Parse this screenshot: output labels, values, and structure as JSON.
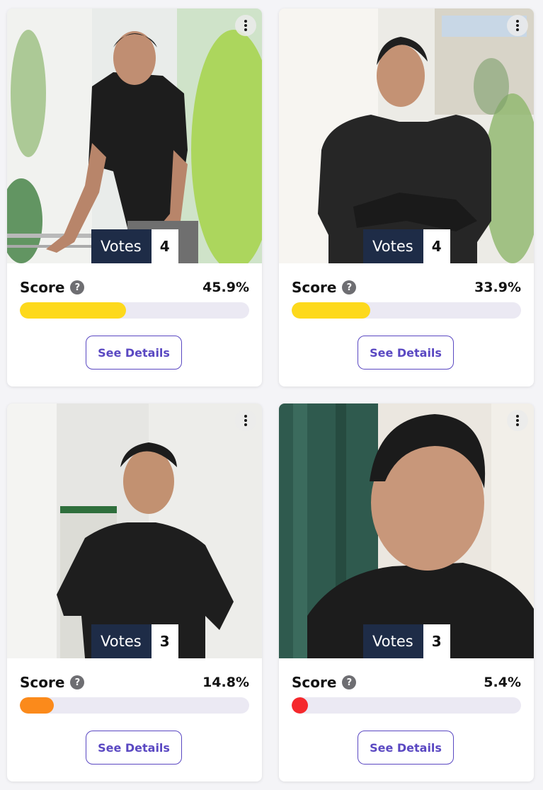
{
  "cards": [
    {
      "votes_label": "Votes",
      "votes": "4",
      "score_label": "Score",
      "score": "45.9%",
      "score_fraction": 0.459,
      "bar_color": "#fdd91c",
      "button": "See Details",
      "help": "?",
      "photo": "man-leaning-on-railing"
    },
    {
      "votes_label": "Votes",
      "votes": "4",
      "score_label": "Score",
      "score": "33.9%",
      "score_fraction": 0.339,
      "bar_color": "#fdd91c",
      "button": "See Details",
      "help": "?",
      "photo": "man-arms-crossed"
    },
    {
      "votes_label": "Votes",
      "votes": "3",
      "score_label": "Score",
      "score": "14.8%",
      "score_fraction": 0.148,
      "bar_color": "#fb8a1b",
      "button": "See Details",
      "help": "?",
      "photo": "man-looking-left"
    },
    {
      "votes_label": "Votes",
      "votes": "3",
      "score_label": "Score",
      "score": "5.4%",
      "score_fraction": 0.054,
      "bar_color": "#f5282c",
      "button": "See Details",
      "help": "?",
      "photo": "man-closeup-looking-down"
    }
  ]
}
